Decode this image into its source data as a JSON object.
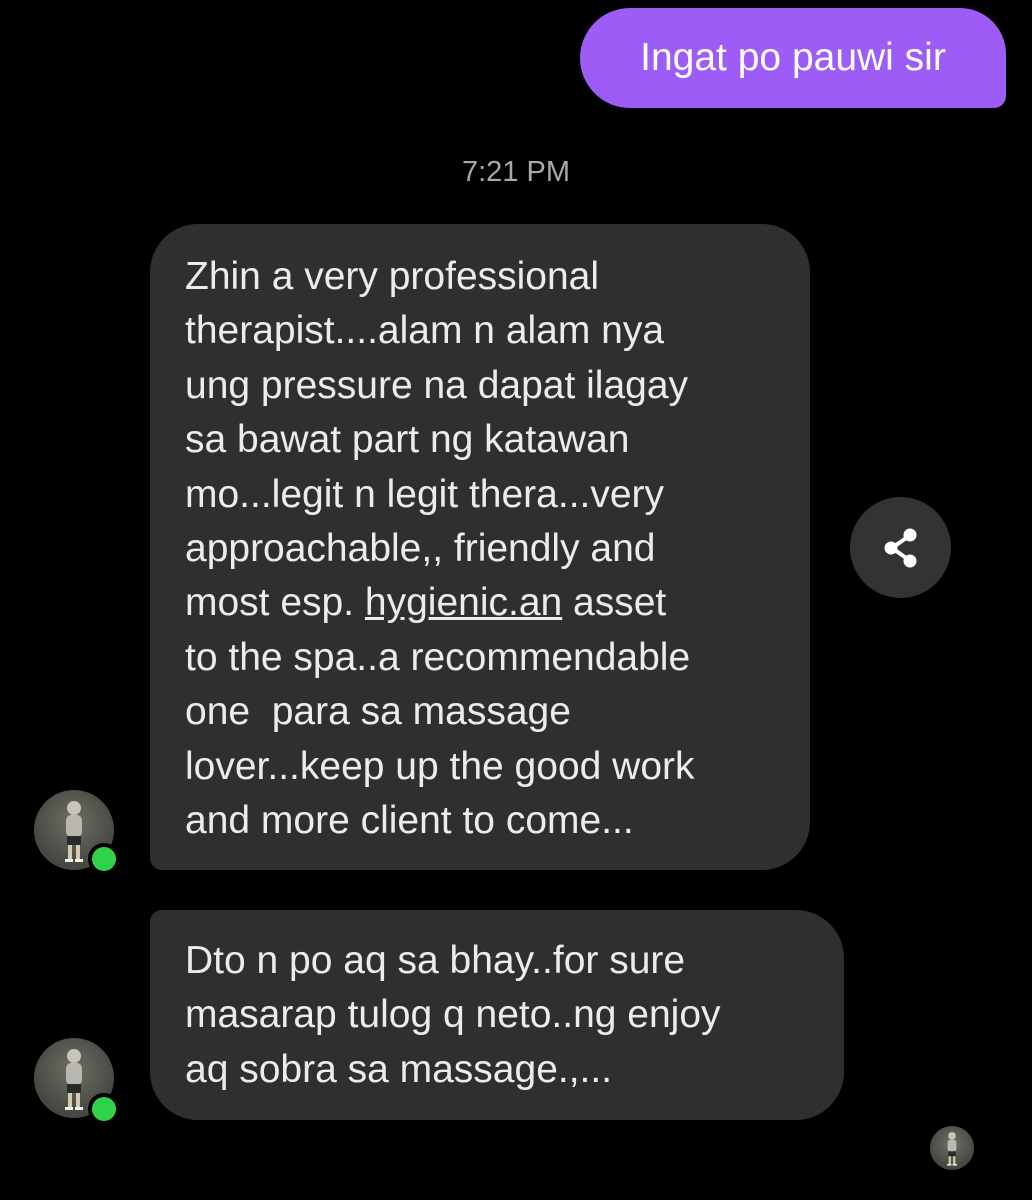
{
  "messages": {
    "outgoing_1": "Ingat po pauwi sir",
    "timestamp": "7:21 PM",
    "incoming_1": {
      "line_1": "Zhin a very professional",
      "line_2": "therapist....alam n alam nya",
      "line_3": "ung pressure na dapat ilagay",
      "line_4": "sa bawat part ng katawan",
      "line_5": "mo...legit n legit thera...very",
      "line_6": "approachable,, friendly and",
      "line_7_prefix": "most esp. ",
      "line_7_link": "hygienic.an",
      "line_7_suffix": " asset",
      "line_8": "to the spa..a recommendable",
      "line_9": "one  para sa massage",
      "line_10": "lover...keep up the good work",
      "line_11": "and more client to come..."
    },
    "incoming_2": {
      "line_1": "Dto n po aq sa bhay..for sure",
      "line_2": "masarap tulog q neto..ng enjoy",
      "line_3": "aq sobra sa massage.,..."
    }
  },
  "icons": {
    "share": "share-icon",
    "avatar": "contact-avatar",
    "online": "online-status-dot"
  },
  "colors": {
    "outgoing_bubble": "#9d5cf5",
    "incoming_bubble": "#2f2f2f",
    "online": "#2fd24a"
  }
}
